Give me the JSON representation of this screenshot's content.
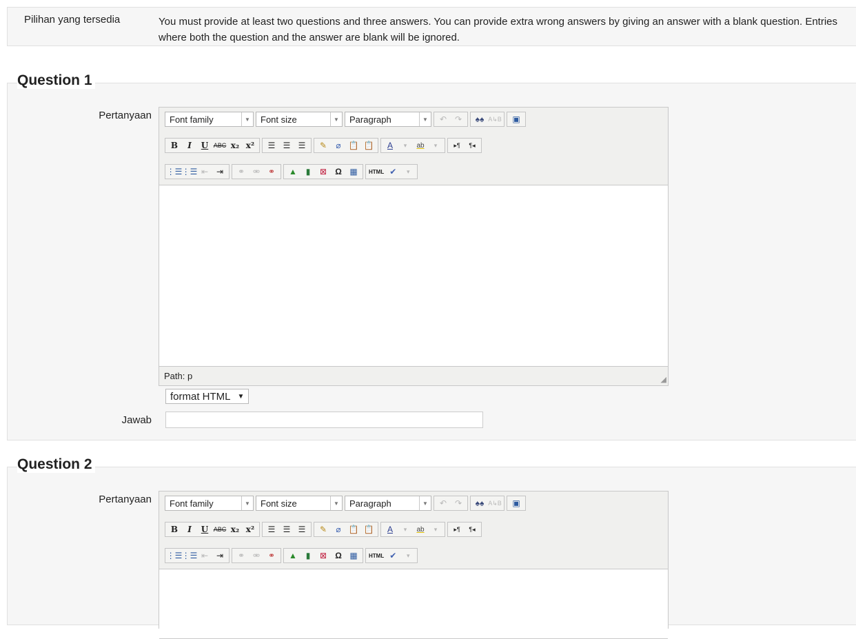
{
  "info": {
    "label": "Pilihan yang tersedia",
    "text": "You must provide at least two questions and three answers. You can provide extra wrong answers by giving an answer with a blank question. Entries where both the question and the answer are blank will be ignored."
  },
  "questions": [
    {
      "legend": "Question 1",
      "question_label": "Pertanyaan",
      "font_family": "Font family",
      "font_size": "Font size",
      "paragraph": "Paragraph",
      "path": "Path: p",
      "format": "format HTML",
      "answer_label": "Jawab",
      "answer_value": ""
    },
    {
      "legend": "Question 2",
      "question_label": "Pertanyaan",
      "font_family": "Font family",
      "font_size": "Font size",
      "paragraph": "Paragraph"
    }
  ],
  "toolbar_icons": {
    "bold": "B",
    "italic": "I",
    "underline": "U",
    "strike": "ABC",
    "sub": "x₂",
    "sup": "x²",
    "omega": "Ω",
    "html": "HTML",
    "ltr": "▸¶",
    "rtl": "¶◂"
  },
  "colors": {
    "panel": "#f6f6f6",
    "editor_toolbar": "#f0f0ee",
    "border": "#c8c8c8"
  }
}
